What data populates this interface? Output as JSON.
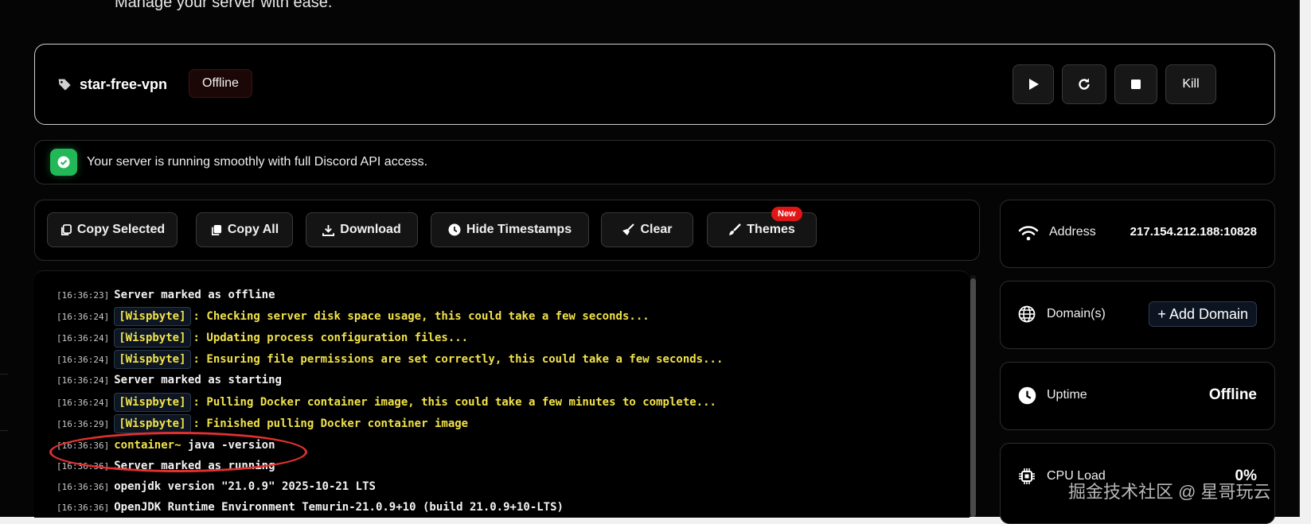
{
  "header": {
    "subtitle": "Manage your server with ease."
  },
  "server": {
    "name": "star-free-vpn",
    "status": "Offline",
    "controls": {
      "start": "start",
      "restart": "restart",
      "stop": "stop",
      "kill": "Kill"
    }
  },
  "notice": {
    "text": "Your server is running smoothly with full Discord API access."
  },
  "toolbar": {
    "copy_selected": "Copy Selected",
    "copy_all": "Copy All",
    "download": "Download",
    "hide_timestamps": "Hide Timestamps",
    "clear": "Clear",
    "themes": "Themes",
    "new_badge": "New"
  },
  "console": {
    "lines": [
      {
        "ts": "[16:36:23]",
        "tag": "",
        "text": "Server marked as offline"
      },
      {
        "ts": "[16:36:24]",
        "tag": "[Wispbyte]",
        "text": ": Checking server disk space usage, this could take a few seconds..."
      },
      {
        "ts": "[16:36:24]",
        "tag": "[Wispbyte]",
        "text": ": Updating process configuration files..."
      },
      {
        "ts": "[16:36:24]",
        "tag": "[Wispbyte]",
        "text": ": Ensuring file permissions are set correctly, this could take a few seconds..."
      },
      {
        "ts": "[16:36:24]",
        "tag": "",
        "text": "Server marked as starting"
      },
      {
        "ts": "[16:36:24]",
        "tag": "[Wispbyte]",
        "text": ": Pulling Docker container image, this could take a few minutes to complete..."
      },
      {
        "ts": "[16:36:29]",
        "tag": "[Wispbyte]",
        "text": ": Finished pulling Docker container image"
      },
      {
        "ts": "[16:36:36]",
        "prompt": "container~",
        "text": "java -version"
      },
      {
        "ts": "[16:36:36]",
        "tag": "",
        "text": "Server marked as running"
      },
      {
        "ts": "[16:36:36]",
        "tag": "",
        "text": "openjdk version \"21.0.9\" 2025-10-21 LTS"
      },
      {
        "ts": "[16:36:36]",
        "tag": "",
        "text": "OpenJDK Runtime Environment Temurin-21.0.9+10 (build 21.0.9+10-LTS)"
      }
    ]
  },
  "sidebar": {
    "address": {
      "label": "Address",
      "value": "217.154.212.188:10828"
    },
    "domains": {
      "label": "Domain(s)",
      "button": "+ Add Domain"
    },
    "uptime": {
      "label": "Uptime",
      "value": "Offline"
    },
    "cpu": {
      "label": "CPU Load",
      "value": "0%"
    }
  },
  "watermark": "掘金技术社区 @ 星哥玩云",
  "colors": {
    "accent_green": "#22b858",
    "log_yellow": "#f1e24a",
    "badge_red": "#e01616",
    "annotation_red": "#e23030"
  }
}
